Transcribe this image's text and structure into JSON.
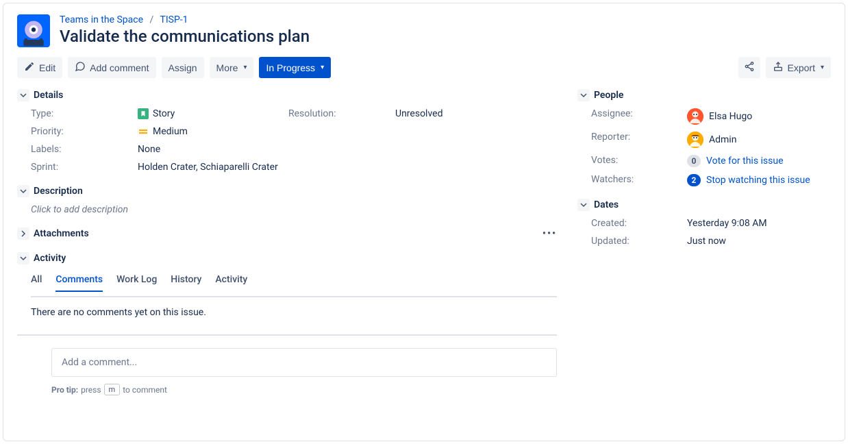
{
  "breadcrumb": {
    "project": "Teams in the Space",
    "key": "TISP-1"
  },
  "title": "Validate the communications plan",
  "toolbar": {
    "edit": "Edit",
    "add_comment": "Add comment",
    "assign": "Assign",
    "more": "More",
    "status": "In Progress",
    "export": "Export"
  },
  "sections": {
    "details": "Details",
    "description": "Description",
    "attachments": "Attachments",
    "activity": "Activity",
    "people": "People",
    "dates": "Dates"
  },
  "details": {
    "type_label": "Type:",
    "type_value": "Story",
    "priority_label": "Priority:",
    "priority_value": "Medium",
    "labels_label": "Labels:",
    "labels_value": "None",
    "sprint_label": "Sprint:",
    "sprint_value": "Holden Crater, Schiaparelli Crater",
    "resolution_label": "Resolution:",
    "resolution_value": "Unresolved"
  },
  "description_placeholder": "Click to add description",
  "activity": {
    "tabs": {
      "all": "All",
      "comments": "Comments",
      "work_log": "Work Log",
      "history": "History",
      "activity": "Activity"
    },
    "empty": "There are no comments yet on this issue.",
    "comment_placeholder": "Add a comment...",
    "protip_label": "Pro tip:",
    "protip_before": "press",
    "protip_key": "m",
    "protip_after": "to comment"
  },
  "people": {
    "assignee_label": "Assignee:",
    "assignee_value": "Elsa Hugo",
    "reporter_label": "Reporter:",
    "reporter_value": "Admin",
    "votes_label": "Votes:",
    "votes_count": "0",
    "votes_link": "Vote for this issue",
    "watchers_label": "Watchers:",
    "watchers_count": "2",
    "watchers_link": "Stop watching this issue"
  },
  "dates": {
    "created_label": "Created:",
    "created_value": "Yesterday 9:08 AM",
    "updated_label": "Updated:",
    "updated_value": "Just now"
  }
}
